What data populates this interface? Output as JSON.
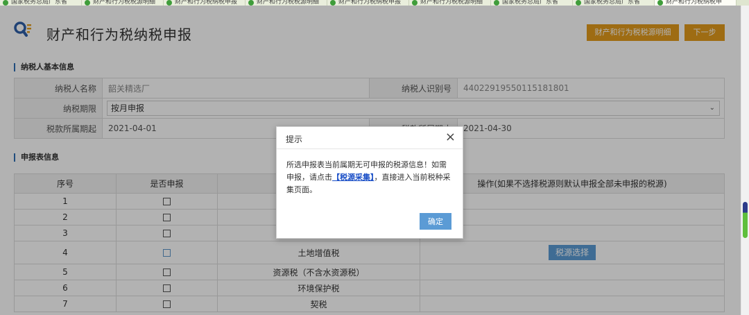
{
  "browser_tabs": [
    {
      "label": "国家税务总局广东省"
    },
    {
      "label": "财产和行为税税源明细"
    },
    {
      "label": "财产和行为税纳税申报"
    },
    {
      "label": "财产和行为税税源明细"
    },
    {
      "label": "财产和行为税纳税申报"
    },
    {
      "label": "财产和行为税税源明细"
    },
    {
      "label": "国家税务总局广东省"
    },
    {
      "label": "国家税务总局广东省"
    },
    {
      "label": "财产和行为税纳税申"
    }
  ],
  "header": {
    "title": "财产和行为税纳税申报",
    "detail_button": "财产和行为税税源明细",
    "next_button": "下一步"
  },
  "taxpayer_section": {
    "title": "纳税人基本信息",
    "name_label": "纳税人名称",
    "name_value": "韶关精选厂",
    "id_label": "纳税人识别号",
    "id_value": "440229195501151818​01",
    "period_label": "纳税期限",
    "period_value": "按月申报",
    "start_label": "税款所属期起",
    "start_value": "2021-04-01",
    "end_label": "税款所属期止",
    "end_value": "2021-04-30"
  },
  "declaration_section": {
    "title": "申报表信息",
    "columns": {
      "seq": "序号",
      "declare": "是否申报",
      "tax_name": "",
      "action": "操作(如果不选择税源则默认申报全部未申报的税源)"
    },
    "rows": [
      {
        "seq": "1",
        "tax_name": "",
        "action": ""
      },
      {
        "seq": "2",
        "tax_name": "",
        "action": ""
      },
      {
        "seq": "3",
        "tax_name": "",
        "action": ""
      },
      {
        "seq": "4",
        "tax_name": "土地增值税",
        "action": "税源选择"
      },
      {
        "seq": "5",
        "tax_name": "资源税（不含水资源税）",
        "action": ""
      },
      {
        "seq": "6",
        "tax_name": "环境保护税",
        "action": ""
      },
      {
        "seq": "7",
        "tax_name": "契税",
        "action": ""
      }
    ]
  },
  "dialog": {
    "title": "提示",
    "text_before": "所选申报表当前属期无可申报的税源信息！如需申报，请点击",
    "link_text": "【税源采集】",
    "text_after": "，直接进入当前税种采集页面。",
    "ok_button": "确定"
  },
  "colors": {
    "accent_orange": "#e39b1c",
    "accent_blue": "#5b9bd5",
    "section_bar": "#2f6fb3",
    "link": "#1a4fc7"
  }
}
